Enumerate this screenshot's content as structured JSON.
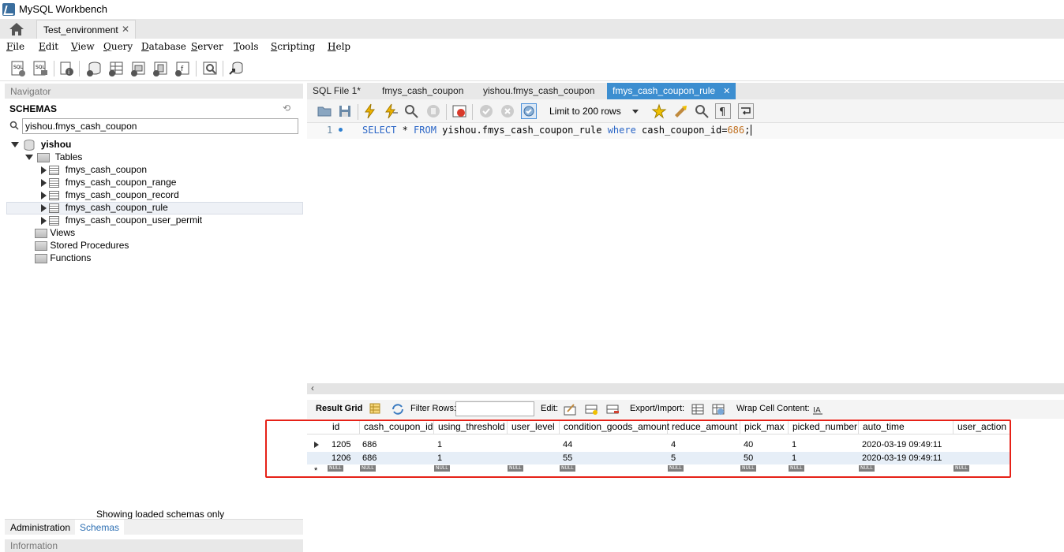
{
  "window": {
    "title": "MySQL Workbench"
  },
  "connection_tab": {
    "label": "Test_environment",
    "close": "✕"
  },
  "menu": [
    {
      "pre": "",
      "key": "F",
      "post": "ile"
    },
    {
      "pre": "",
      "key": "E",
      "post": "dit"
    },
    {
      "pre": "",
      "key": "V",
      "post": "iew"
    },
    {
      "pre": "",
      "key": "Q",
      "post": "uery"
    },
    {
      "pre": "",
      "key": "D",
      "post": "atabase"
    },
    {
      "pre": "",
      "key": "S",
      "post": "erver"
    },
    {
      "pre": "",
      "key": "T",
      "post": "ools"
    },
    {
      "pre": "",
      "key": "S",
      "post": "cripting"
    },
    {
      "pre": "",
      "key": "H",
      "post": "elp"
    }
  ],
  "navigator": {
    "header": "Navigator",
    "schemas_label": "SCHEMAS",
    "search_value": "yishou.fmys_cash_coupon",
    "schema": "yishou",
    "tables_label": "Tables",
    "tables": [
      "fmys_cash_coupon",
      "fmys_cash_coupon_range",
      "fmys_cash_coupon_record",
      "fmys_cash_coupon_rule",
      "fmys_cash_coupon_user_permit"
    ],
    "views": "Views",
    "stored_procedures": "Stored Procedures",
    "functions": "Functions",
    "status": "Showing loaded schemas only",
    "tab_admin": "Administration",
    "tab_schemas": "Schemas",
    "info": "Information"
  },
  "editor_tabs": [
    "SQL File 1*",
    "fmys_cash_coupon",
    "yishou.fmys_cash_coupon",
    "fmys_cash_coupon_rule"
  ],
  "editor_tab_close": "✕",
  "limit": "Limit to 200 rows",
  "query": {
    "line": "1",
    "sql_select": "SELECT",
    "sql_star": " * ",
    "sql_from": "FROM",
    "sql_table": " yishou.fmys_cash_coupon_rule ",
    "sql_where": "where",
    "sql_cond": " cash_coupon_id=",
    "sql_val": "686",
    "sql_end": ";"
  },
  "results": {
    "result_grid": "Result Grid",
    "filter_rows": "Filter Rows:",
    "edit": "Edit:",
    "export_import": "Export/Import:",
    "wrap": "Wrap Cell Content:",
    "columns": [
      "id",
      "cash_coupon_id",
      "using_threshold",
      "user_level",
      "condition_goods_amount",
      "reduce_amount",
      "pick_max",
      "picked_number",
      "auto_time",
      "user_action"
    ],
    "rows": [
      [
        "1205",
        "686",
        "1",
        "",
        "44",
        "4",
        "40",
        "1",
        "2020-03-19 09:49:11",
        ""
      ],
      [
        "1206",
        "686",
        "1",
        "",
        "55",
        "5",
        "50",
        "1",
        "2020-03-19 09:49:11",
        ""
      ]
    ],
    "null_label": "NULL",
    "new_row_marker": "*"
  }
}
